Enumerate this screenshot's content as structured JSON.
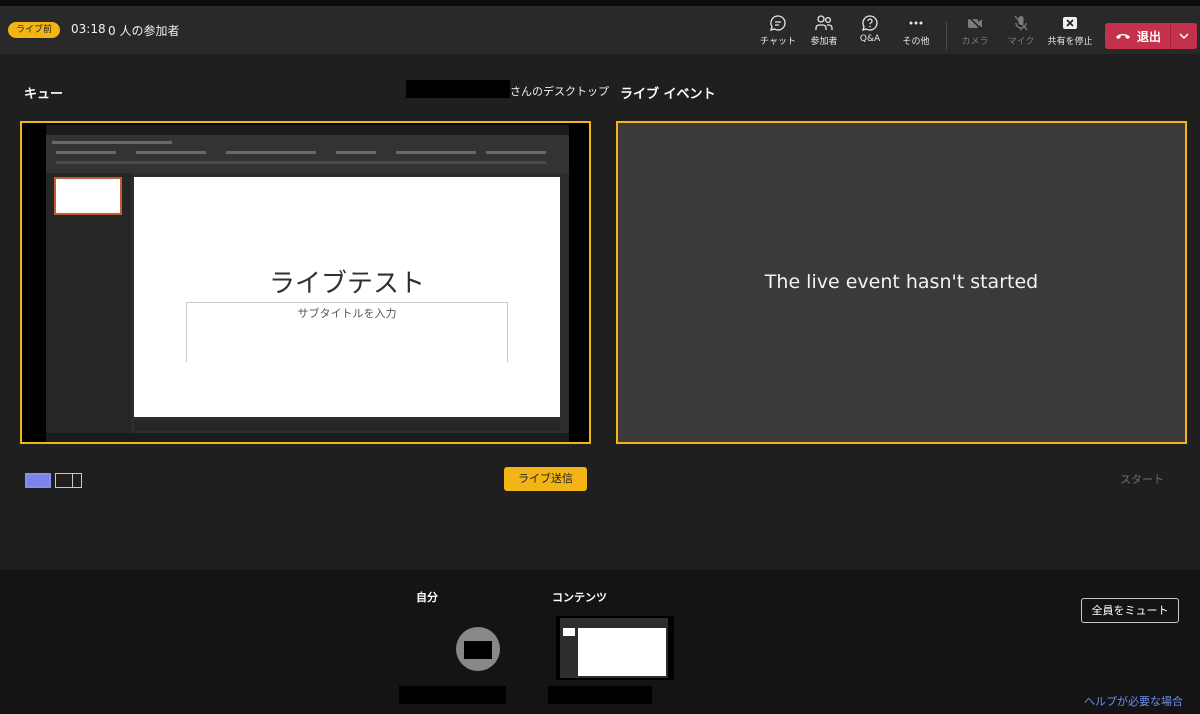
{
  "header": {
    "status_badge": "ライブ前",
    "timer": "03:18",
    "attendee_count": "0 人の参加者",
    "buttons": {
      "chat": "チャット",
      "participants": "参加者",
      "qa": "Q&A",
      "more": "その他",
      "camera": "カメラ",
      "mic": "マイク",
      "stop_sharing": "共有を停止",
      "leave": "退出"
    }
  },
  "queue": {
    "title": "キュー",
    "desktop_label": "さんのデスクトップ",
    "slide_title": "ライブテスト",
    "slide_subtitle": "サブタイトルを入力",
    "send_live": "ライブ送信"
  },
  "live_event": {
    "title": "ライブ イベント",
    "message": "The live event hasn't started",
    "start": "スタート"
  },
  "bottom": {
    "self_label": "自分",
    "content_label": "コンテンツ",
    "mute_all": "全員をミュート",
    "help": "ヘルプが必要な場合"
  },
  "colors": {
    "accent": "#f2b515",
    "leave": "#c4314b",
    "layout_active": "#7b83eb",
    "link": "#6f8de8"
  }
}
